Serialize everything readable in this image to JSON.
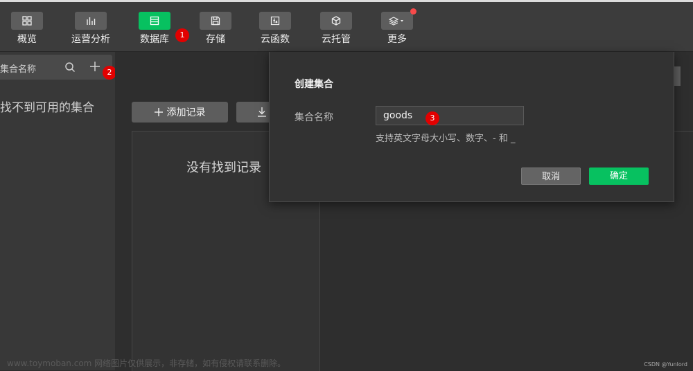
{
  "toolbar": {
    "items": [
      {
        "label": "概览",
        "icon": "grid-icon"
      },
      {
        "label": "运营分析",
        "icon": "bar-chart-icon"
      },
      {
        "label": "数据库",
        "icon": "database-icon"
      },
      {
        "label": "存储",
        "icon": "save-icon"
      },
      {
        "label": "云函数",
        "icon": "function-icon"
      },
      {
        "label": "云托管",
        "icon": "cube-icon"
      },
      {
        "label": "更多",
        "icon": "layers-icon"
      }
    ],
    "active": "数据库"
  },
  "badges": {
    "b1": "1",
    "b2": "2",
    "b3": "3"
  },
  "sidebar": {
    "search_placeholder": "集合名称",
    "empty_text": "找不到可用的集合"
  },
  "main": {
    "add_record_label": "添加记录",
    "empty_text": "没有找到记录"
  },
  "dialog": {
    "title": "创建集合",
    "field_label": "集合名称",
    "field_value": "goods",
    "hint": "支持英文字母大小写、数字、- 和 _",
    "cancel_label": "取消",
    "ok_label": "确定"
  },
  "watermark": "www.toymoban.com 网络图片仅供展示，非存储，如有侵权请联系删除。",
  "credit": "CSDN @Yunlord",
  "colors": {
    "accent": "#07c160",
    "badge": "#e20000"
  }
}
